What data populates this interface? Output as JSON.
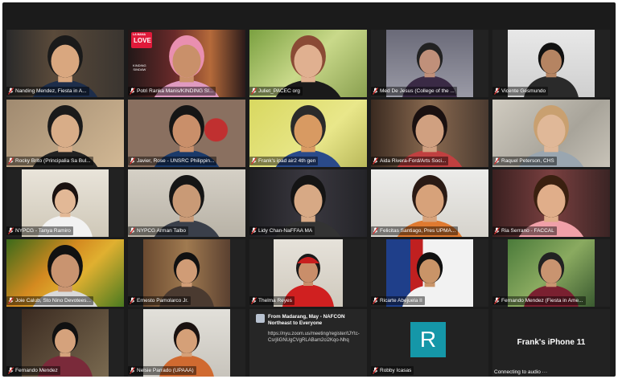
{
  "meeting": {
    "participants": [
      {
        "name": "Nanding Mendez, Fiesta in A..."
      },
      {
        "name": "Potri Ranka Manis/KINDING SI..."
      },
      {
        "name": "Juliet_PACEC org"
      },
      {
        "name": "Med De Jesus (College of the ..."
      },
      {
        "name": "Vicente Gesmundo"
      },
      {
        "name": "Rocky Brito  (Principalia Sa Bul..."
      },
      {
        "name": "Javier, Rose - UNSRC Philippin..."
      },
      {
        "name": "Frank's ipad air2 4th gen"
      },
      {
        "name": "Aida Rivera-Ford/Arts Soci..."
      },
      {
        "name": "Raquel Peterson, CHS"
      },
      {
        "name": "NYPCG - Tanya Ramiro"
      },
      {
        "name": "NYPCG Arman Talbo"
      },
      {
        "name": "Lidy Chan-NaFFAA MA"
      },
      {
        "name": "Felicitas Santiago, Pres UPMA..."
      },
      {
        "name": "Ria Serrano - FACCAL"
      },
      {
        "name": "Joie Calub, Sto Nino Devotees..."
      },
      {
        "name": "Ernesto Pamolarco Jr."
      },
      {
        "name": "Thelma Reyes"
      },
      {
        "name": "Ricarte Abejuela II"
      },
      {
        "name": "Fernando Mendez (Fiesta in Ame..."
      },
      {
        "name": "Fernando Mendez"
      },
      {
        "name": "Nelsie Parrado (UPAAA)"
      },
      {
        "name": "Robby Icasas"
      }
    ],
    "chat": {
      "from": "From Madarang, May - NAFCON Northeast to Everyone",
      "message": "https://nyu.zoom.us/meeting/register/tJYtc-CsrjIiGNUgCVgRLABam2ci2Kqo-Nhq"
    },
    "robby_avatar_letter": "R",
    "phone_tile": {
      "label": "Frank's iPhone 11",
      "status": "Connecting to audio"
    },
    "love_banner": {
      "top": "LA MANA",
      "big": "LOVE",
      "sub": "KINDING\nSINDAW"
    }
  }
}
